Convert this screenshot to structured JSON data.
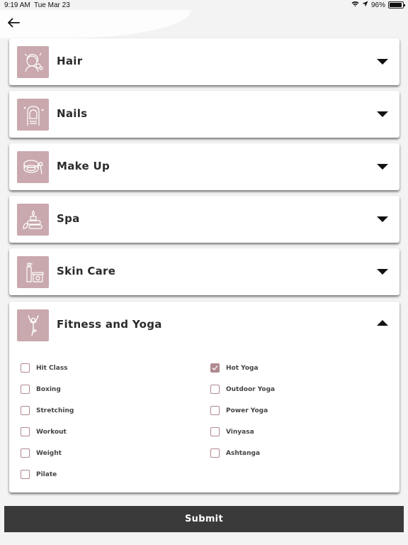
{
  "status_bar": {
    "time": "9:19 AM",
    "date": "Tue Mar 23",
    "battery": "96%",
    "battery_level": 0.96
  },
  "categories": [
    {
      "title": "Hair",
      "icon": "hair-icon",
      "expanded": false
    },
    {
      "title": "Nails",
      "icon": "nails-icon",
      "expanded": false
    },
    {
      "title": "Make Up",
      "icon": "makeup-icon",
      "expanded": false
    },
    {
      "title": "Spa",
      "icon": "spa-icon",
      "expanded": false
    },
    {
      "title": "Skin Care",
      "icon": "skin-care-icon",
      "expanded": false
    },
    {
      "title": "Fitness and Yoga",
      "icon": "yoga-icon",
      "expanded": true
    }
  ],
  "fitness_options": {
    "left": [
      {
        "label": "Hit Class",
        "checked": false
      },
      {
        "label": "Boxing",
        "checked": false
      },
      {
        "label": "Stretching",
        "checked": false
      },
      {
        "label": "Workout",
        "checked": false
      },
      {
        "label": "Weight",
        "checked": false
      },
      {
        "label": "Pilate",
        "checked": false
      }
    ],
    "right": [
      {
        "label": "Hot Yoga",
        "checked": true
      },
      {
        "label": "Outdoor Yoga",
        "checked": false
      },
      {
        "label": "Power Yoga",
        "checked": false
      },
      {
        "label": "Vinyasa",
        "checked": false
      },
      {
        "label": "Ashtanga",
        "checked": false
      }
    ]
  },
  "submit_label": "Submit",
  "colors": {
    "accent": "#c9a9ae",
    "checkbox": "#b08a90",
    "submit_bg": "#3a3a3a"
  }
}
